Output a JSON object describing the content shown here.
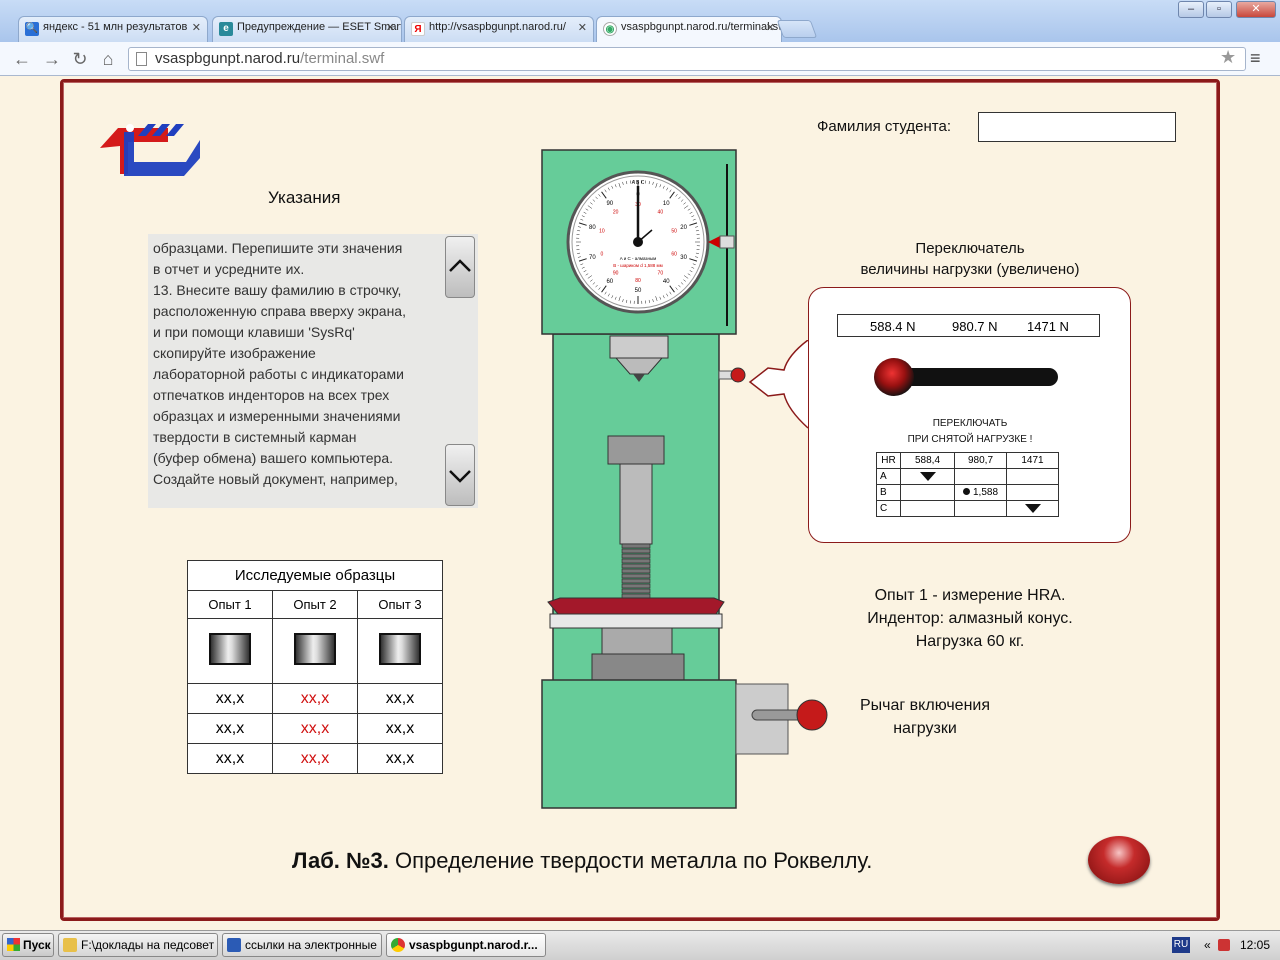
{
  "browser": {
    "tabs": [
      {
        "label": "яндекс - 51 млн результатов",
        "icon": "search-icon",
        "active": false
      },
      {
        "label": "Предупреждение — ESET Smart Security",
        "icon": "eset-icon",
        "active": false
      },
      {
        "label": "http://vsaspbgunpt.narod.ru/",
        "icon": "yandex-icon",
        "active": false
      },
      {
        "label": "vsaspbgunpt.narod.ru/terminal.swf",
        "icon": "page-icon",
        "active": true
      }
    ],
    "close_glyph": "✕",
    "url_host": "vsaspbgunpt.narod.ru",
    "url_path": "/terminal.swf",
    "window_buttons": {
      "minimize": "–",
      "maximize": "▫",
      "close": "✕"
    }
  },
  "app": {
    "student_label": "Фамилия студента:",
    "student_value": "",
    "instructions_title": "Указания",
    "instructions_text": "образцами. Перепишите эти значения\nв отчет и усредните их.\n   13. Внесите вашу фамилию в строчку,\nрасположенную справа вверху экрана,\nи при помощи клавиши 'SysRq'\nскопируйте изображение\nлабораторной работы с индикаторами\nотпечатков инденторов на всех трех\nобразцах и измеренными значениями\nтвердости в системный карман\n(буфер обмена) вашего компьютера.\nСоздайте новый документ, например,",
    "samples": {
      "title": "Исследуемые образцы",
      "columns": [
        "Опыт 1",
        "Опыт 2",
        "Опыт 3"
      ],
      "rows": [
        [
          "хх,х",
          "хх,х",
          "хх,х"
        ],
        [
          "хх,х",
          "хх,х",
          "хх,х"
        ],
        [
          "хх,х",
          "хх,х",
          "хх,х"
        ]
      ],
      "highlight_column": 1,
      "highlight_color": "#d01010"
    },
    "switch": {
      "title_line1": "Переключатель",
      "title_line2": "величины нагрузки (увеличено)",
      "loads": [
        "588.4 N",
        "980.7 N",
        "1471 N"
      ],
      "note_line1": "ПЕРЕКЛЮЧАТЬ",
      "note_line2": "ПРИ СНЯТОЙ НАГРУЗКЕ !",
      "table_header": [
        "HR",
        "588,4",
        "980,7",
        "1471"
      ],
      "table_rows": [
        {
          "scale": "A",
          "cells": [
            "▼",
            "",
            ""
          ]
        },
        {
          "scale": "B",
          "cells": [
            "",
            "● 1,588",
            ""
          ]
        },
        {
          "scale": "C",
          "cells": [
            "",
            "",
            "▼"
          ]
        }
      ]
    },
    "experiment": {
      "line1": "Опыт 1 - измерение HRA.",
      "line2": "Индентор: алмазный конус.",
      "line3": "Нагрузка 60 кг."
    },
    "lever_label_line1": "Рычаг включения",
    "lever_label_line2": "нагрузки",
    "gauge": {
      "scale_letters": "A B C",
      "inner_text1": "A и C - алмазным",
      "inner_text2": "B - шариком d 1,588 мм",
      "black_labels": [
        "0",
        "10",
        "20",
        "30",
        "40",
        "50",
        "60",
        "70",
        "80",
        "90"
      ],
      "red_labels": [
        "30",
        "40",
        "50",
        "60",
        "70",
        "80",
        "90",
        "0",
        "10",
        "20"
      ],
      "reading": "0"
    },
    "lab_title_bold": "Лаб. №3.",
    "lab_title_rest": " Определение твердости металла по Роквеллу.",
    "colors": {
      "frame": "#8b1a1a",
      "machine_green": "#66cc99",
      "background": "#fbf3e2",
      "accent_red": "#c52b2b"
    }
  },
  "taskbar": {
    "start": "Пуск",
    "tasks": [
      {
        "label": "F:\\доклады на педсовет",
        "icon": "folder-icon",
        "active": false
      },
      {
        "label": "ссылки на электронные ...",
        "icon": "word-icon",
        "active": false
      },
      {
        "label": "vsaspbgunpt.narod.r...",
        "icon": "chrome-icon",
        "active": true
      }
    ],
    "language": "RU",
    "tray_chevron": "«",
    "time": "12:05"
  }
}
